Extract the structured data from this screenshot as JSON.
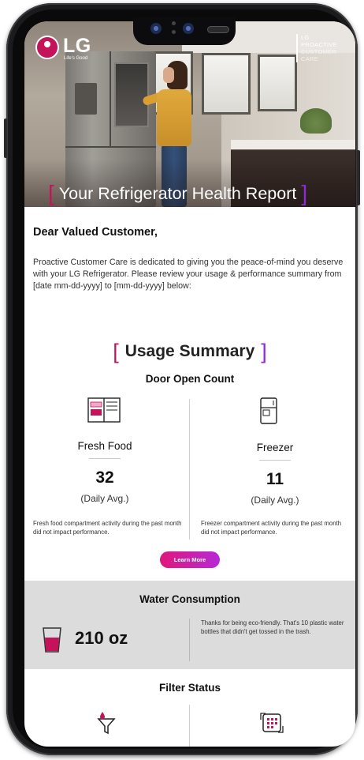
{
  "hero": {
    "brand": "LG",
    "tagline": "Life's Good",
    "program_lines": [
      "LG",
      "PROACTIVE",
      "CUSTOMER",
      "CARE"
    ],
    "title": "Your Refrigerator Health Report",
    "bracket_open": "[",
    "bracket_close": "]"
  },
  "email": {
    "greeting": "Dear Valued Customer,",
    "intro": "Proactive Customer Care is dedicated to giving you the peace-of-mind you deserve with your LG Refrigerator. Please review your usage & performance summary from [date mm-dd-yyyy] to [mm-dd-yyyy] below:"
  },
  "usage": {
    "heading": "Usage Summary",
    "bracket_open": "[",
    "bracket_close": "]",
    "door_title": "Door Open Count",
    "fresh": {
      "label": "Fresh Food",
      "count": "32",
      "avg": "(Daily Avg.)",
      "note": "Fresh food compartment activity during the past month did not impact performance.",
      "icon": "french-door-fridge-icon"
    },
    "freezer": {
      "label": "Freezer",
      "count": "11",
      "avg": "(Daily Avg.)",
      "note": "Freezer compartment activity during the past month did not impact performance.",
      "icon": "freezer-icon"
    },
    "learn_more": "Learn More"
  },
  "water": {
    "title": "Water Consumption",
    "amount": "210 oz",
    "note": "Thanks for being eco-friendly. That's 10 plastic water bottles that didn't get tossed in the trash.",
    "icon": "water-cup-icon"
  },
  "filter": {
    "title": "Filter Status",
    "icons": [
      "water-filter-icon",
      "air-filter-icon"
    ]
  },
  "colors": {
    "magenta": "#c4135a",
    "purple": "#8e2bd4",
    "button_gradient_start": "#e0177a",
    "button_gradient_end": "#b62ad6",
    "band_gray": "#dcdcdc"
  }
}
